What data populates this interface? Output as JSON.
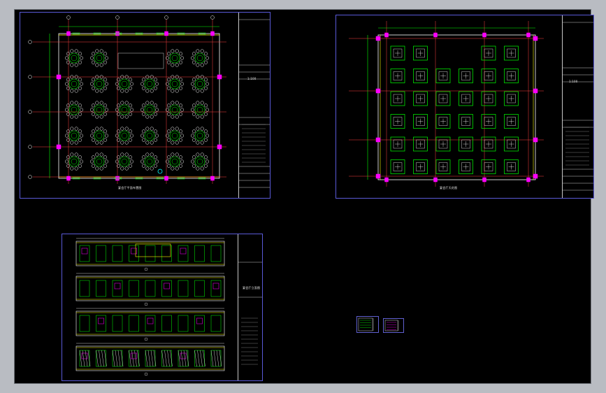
{
  "app": {
    "background_color": "#b9bcc2",
    "viewport_color": "#000000"
  },
  "sheets": [
    {
      "id": "banquet-layout",
      "title_text": "宴会厅平面布置图",
      "scale_text": "1:100",
      "table_grid": {
        "rows": 5,
        "cols": 6
      },
      "colors": {
        "tables": "#ffffff",
        "chairs": "#00ff00",
        "axis": "#ff4040",
        "columns": "#ff00ff",
        "frame": "#5a5ad8"
      }
    },
    {
      "id": "ceiling-plan",
      "title_text": "宴会厅天花图",
      "scale_text": "1:100",
      "panel_grid": {
        "rows": 6,
        "cols": 6
      },
      "colors": {
        "panels": "#00ff00",
        "inner": "#ffffff",
        "axis": "#ff4040",
        "columns": "#ff00ff"
      }
    },
    {
      "id": "elevations",
      "title_text": "宴会厅立面图",
      "elevation_count": 4,
      "colors": {
        "walls": "#00ff00",
        "trim": "#ffff00",
        "panels": "#ff00ff",
        "lines": "#ffffff"
      }
    }
  ],
  "thumbnails": [
    {
      "id": "thumb-1"
    },
    {
      "id": "thumb-2"
    }
  ]
}
